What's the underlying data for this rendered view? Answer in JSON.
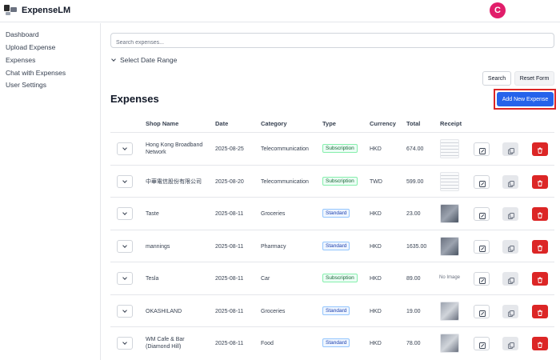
{
  "app": {
    "title": "ExpenseLM",
    "avatar_initial": "C"
  },
  "sidebar": {
    "items": [
      {
        "label": "Dashboard"
      },
      {
        "label": "Upload Expense"
      },
      {
        "label": "Expenses"
      },
      {
        "label": "Chat with Expenses"
      },
      {
        "label": "User Settings"
      }
    ]
  },
  "search": {
    "placeholder": "Search expenses...",
    "value": ""
  },
  "filters": {
    "date_range_label": "Select Date Range"
  },
  "buttons": {
    "search": "Search",
    "reset": "Reset Form",
    "add": "Add New Expense"
  },
  "section": {
    "title": "Expenses"
  },
  "table": {
    "columns": [
      "Shop Name",
      "Date",
      "Category",
      "Type",
      "Currency",
      "Total",
      "Receipt"
    ],
    "rows": [
      {
        "shop": "Hong Kong Broadband Network",
        "date": "2025-08-25",
        "category": "Telecommunication",
        "type": "Subscription",
        "currency": "HKD",
        "total": "674.00",
        "receipt": "light"
      },
      {
        "shop": "中華電信股份有限公司",
        "date": "2025-08-20",
        "category": "Telecommunication",
        "type": "Subscription",
        "currency": "TWD",
        "total": "599.00",
        "receipt": "light"
      },
      {
        "shop": "Taste",
        "date": "2025-08-11",
        "category": "Groceries",
        "type": "Standard",
        "currency": "HKD",
        "total": "23.00",
        "receipt": "dark"
      },
      {
        "shop": "mannings",
        "date": "2025-08-11",
        "category": "Pharmacy",
        "type": "Standard",
        "currency": "HKD",
        "total": "1635.00",
        "receipt": "dark"
      },
      {
        "shop": "Tesla",
        "date": "2025-08-11",
        "category": "Car",
        "type": "Subscription",
        "currency": "HKD",
        "total": "89.00",
        "receipt": "none",
        "no_image_text": "No Image"
      },
      {
        "shop": "OKASHILAND",
        "date": "2025-08-11",
        "category": "Groceries",
        "type": "Standard",
        "currency": "HKD",
        "total": "19.00",
        "receipt": "mid"
      },
      {
        "shop": "WM Cafe & Bar (Diamond Hill)",
        "date": "2025-08-11",
        "category": "Food",
        "type": "Standard",
        "currency": "HKD",
        "total": "78.00",
        "receipt": "mid"
      }
    ]
  },
  "colors": {
    "primary": "#2563eb",
    "danger": "#dc2626",
    "avatar": "#e11d6a",
    "highlight_outline": "#dc2626"
  },
  "icons": {
    "row_actions": [
      "chevron-down-icon",
      "edit-icon",
      "copy-icon",
      "trash-icon"
    ]
  }
}
